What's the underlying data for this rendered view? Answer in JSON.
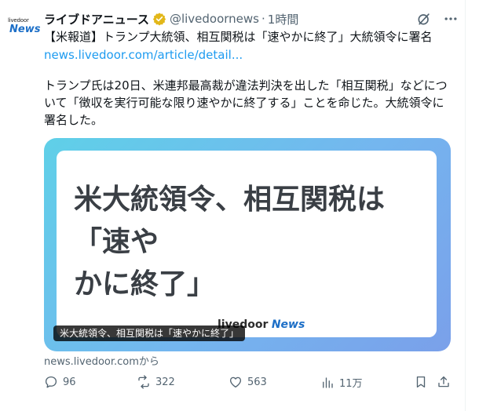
{
  "account": {
    "avatar_top": "livedoor",
    "avatar_bottom": "News",
    "name": "ライブドアニュース",
    "handle": "@livedoornews",
    "separator": "·",
    "time": "1時間"
  },
  "tweet": {
    "headline": "【米報道】トランプ大統領、相互関税は「速やかに終了」大統領令に署名",
    "link_text": "news.livedoor.com/article/detail...",
    "body_lines": [
      "トランプ氏は20日、米連邦最高裁が違法判決を出した「相互関税」などにつ",
      "いて「徴収を実行可能な限り速やかに終了する」ことを命じた。大統領令に",
      "署名した。"
    ]
  },
  "card": {
    "headline_lines": [
      "米大統領令、相互関税は「速や",
      "かに終了」"
    ],
    "brand_a": "livedoor",
    "brand_b": "News",
    "caption": "米大統領令、相互関税は「速やかに終了」",
    "source": "news.livedoor.comから"
  },
  "actions": {
    "replies": "96",
    "reposts": "322",
    "likes": "563",
    "views": "11万"
  },
  "colors": {
    "accent": "#1d9bf0",
    "verified_gold": "#e2b719",
    "brand_blue": "#1d6fc7",
    "muted": "#536471"
  }
}
